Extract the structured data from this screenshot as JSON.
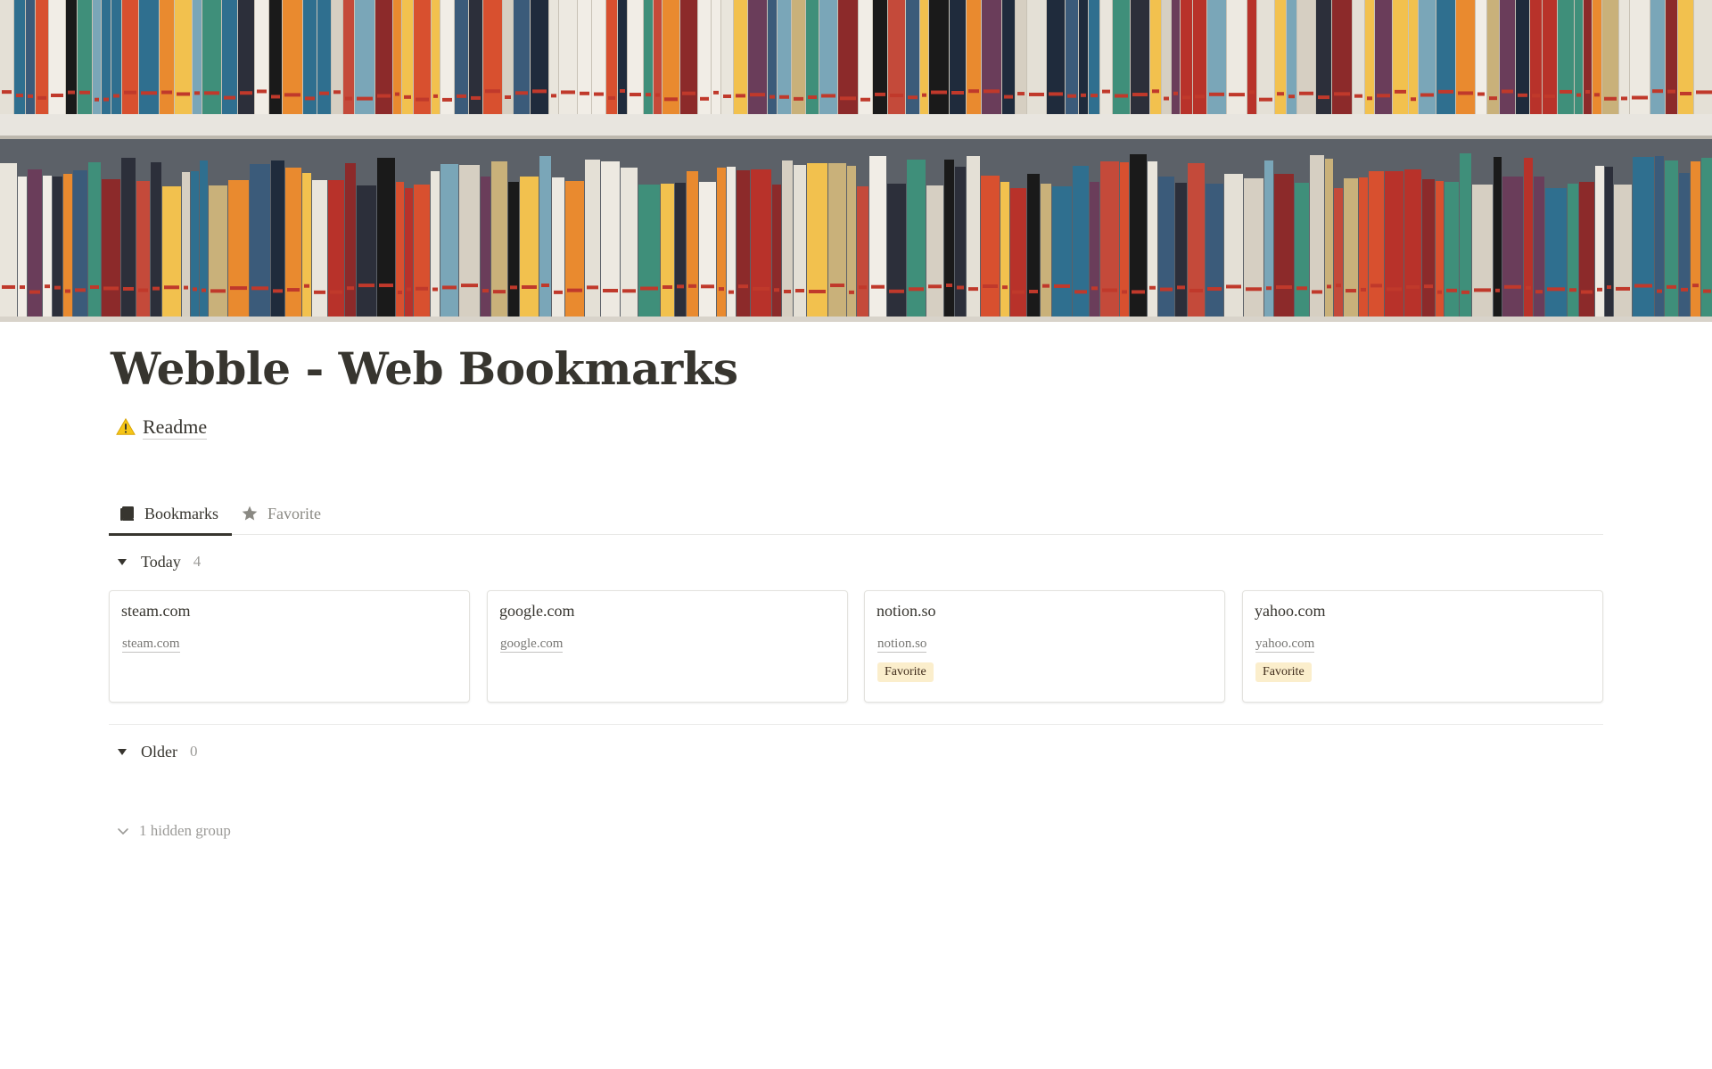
{
  "page": {
    "title": "Webble - Web Bookmarks",
    "readme": {
      "icon": "warning-icon",
      "label": "Readme"
    }
  },
  "tabs": [
    {
      "label": "Bookmarks",
      "icon": "book-icon",
      "active": true
    },
    {
      "label": "Favorite",
      "icon": "star-icon",
      "active": false
    }
  ],
  "groups": {
    "today": {
      "name": "Today",
      "count": "4",
      "cards": [
        {
          "title": "steam.com",
          "url": "steam.com",
          "tag": ""
        },
        {
          "title": "google.com",
          "url": "google.com",
          "tag": ""
        },
        {
          "title": "notion.so",
          "url": "notion.so",
          "tag": "Favorite"
        },
        {
          "title": "yahoo.com",
          "url": "yahoo.com",
          "tag": "Favorite"
        }
      ]
    },
    "older": {
      "name": "Older",
      "count": "0"
    },
    "hidden": {
      "label": "1 hidden group"
    }
  },
  "colors": {
    "text": "#37352f",
    "muted": "#9b9a97",
    "tag_bg": "#fbeecc",
    "tag_text": "#402c1b",
    "warning": "#f5c518"
  }
}
